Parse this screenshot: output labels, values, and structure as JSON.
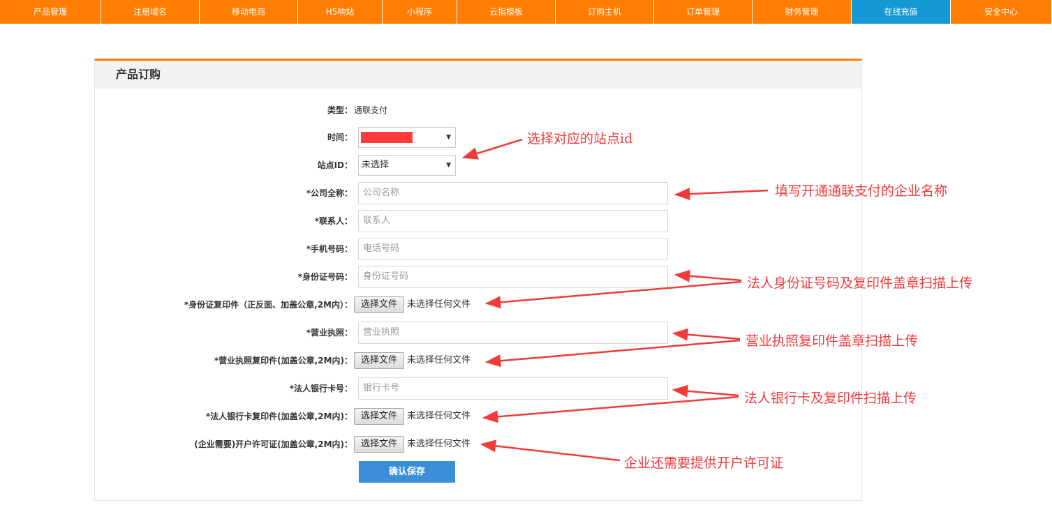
{
  "nav": {
    "items": [
      {
        "label": "产品管理",
        "width": 145
      },
      {
        "label": "注册域名",
        "width": 141
      },
      {
        "label": "移动电商",
        "width": 141
      },
      {
        "label": "H5响站",
        "width": 121
      },
      {
        "label": "小程序",
        "width": 107
      },
      {
        "label": "云指模板",
        "width": 141
      },
      {
        "label": "订购主机",
        "width": 141
      },
      {
        "label": "订单管理",
        "width": 141
      },
      {
        "label": "财务管理",
        "width": 142
      },
      {
        "label": "在线充值",
        "width": 142,
        "active": true
      },
      {
        "label": "安全中心",
        "width": 145
      }
    ]
  },
  "panel": {
    "title": "产品订购"
  },
  "form": {
    "type_label": "类型：",
    "type_value": "通联支付",
    "time_label": "时间：",
    "site_label": "站点ID：",
    "site_value": "未选择",
    "company_label": "*公司全称：",
    "company_placeholder": "公司名称",
    "contact_label": "*联系人：",
    "contact_placeholder": "联系人",
    "phone_label": "*手机号码：",
    "phone_placeholder": "电话号码",
    "idcard_label": "*身份证号码：",
    "idcard_placeholder": "身份证号码",
    "idcard_copy_label": "*身份证复印件（正反面、加盖公章,2M内）：",
    "license_label": "*营业执照：",
    "license_placeholder": "营业执照",
    "license_copy_label": "*营业执照复印件(加盖公章,2M内)：",
    "bankcard_label": "*法人银行卡号：",
    "bankcard_placeholder": "银行卡号",
    "bankcard_copy_label": "*法人银行卡复印件(加盖公章,2M内)：",
    "permit_label": "(企业需要)开户许可证(加盖公章,2M内)：",
    "file_button": "选择文件",
    "file_none": "未选择任何文件",
    "save_label": "确认保存"
  },
  "annotations": {
    "site_note": "选择对应的站点id",
    "company_note": "填写开通通联支付的企业名称",
    "idcard_note": "法人身份证号码及复印件盖章扫描上传",
    "license_note": "营业执照复印件盖章扫描上传",
    "bank_note": "法人银行卡及复印件扫描上传",
    "permit_note": "企业还需要提供开户许可证"
  },
  "colors": {
    "nav_orange": "#ff7d00",
    "nav_active_blue": "#1499d6",
    "save_blue": "#3b8ed8",
    "annotation_red": "#f03b3b"
  }
}
